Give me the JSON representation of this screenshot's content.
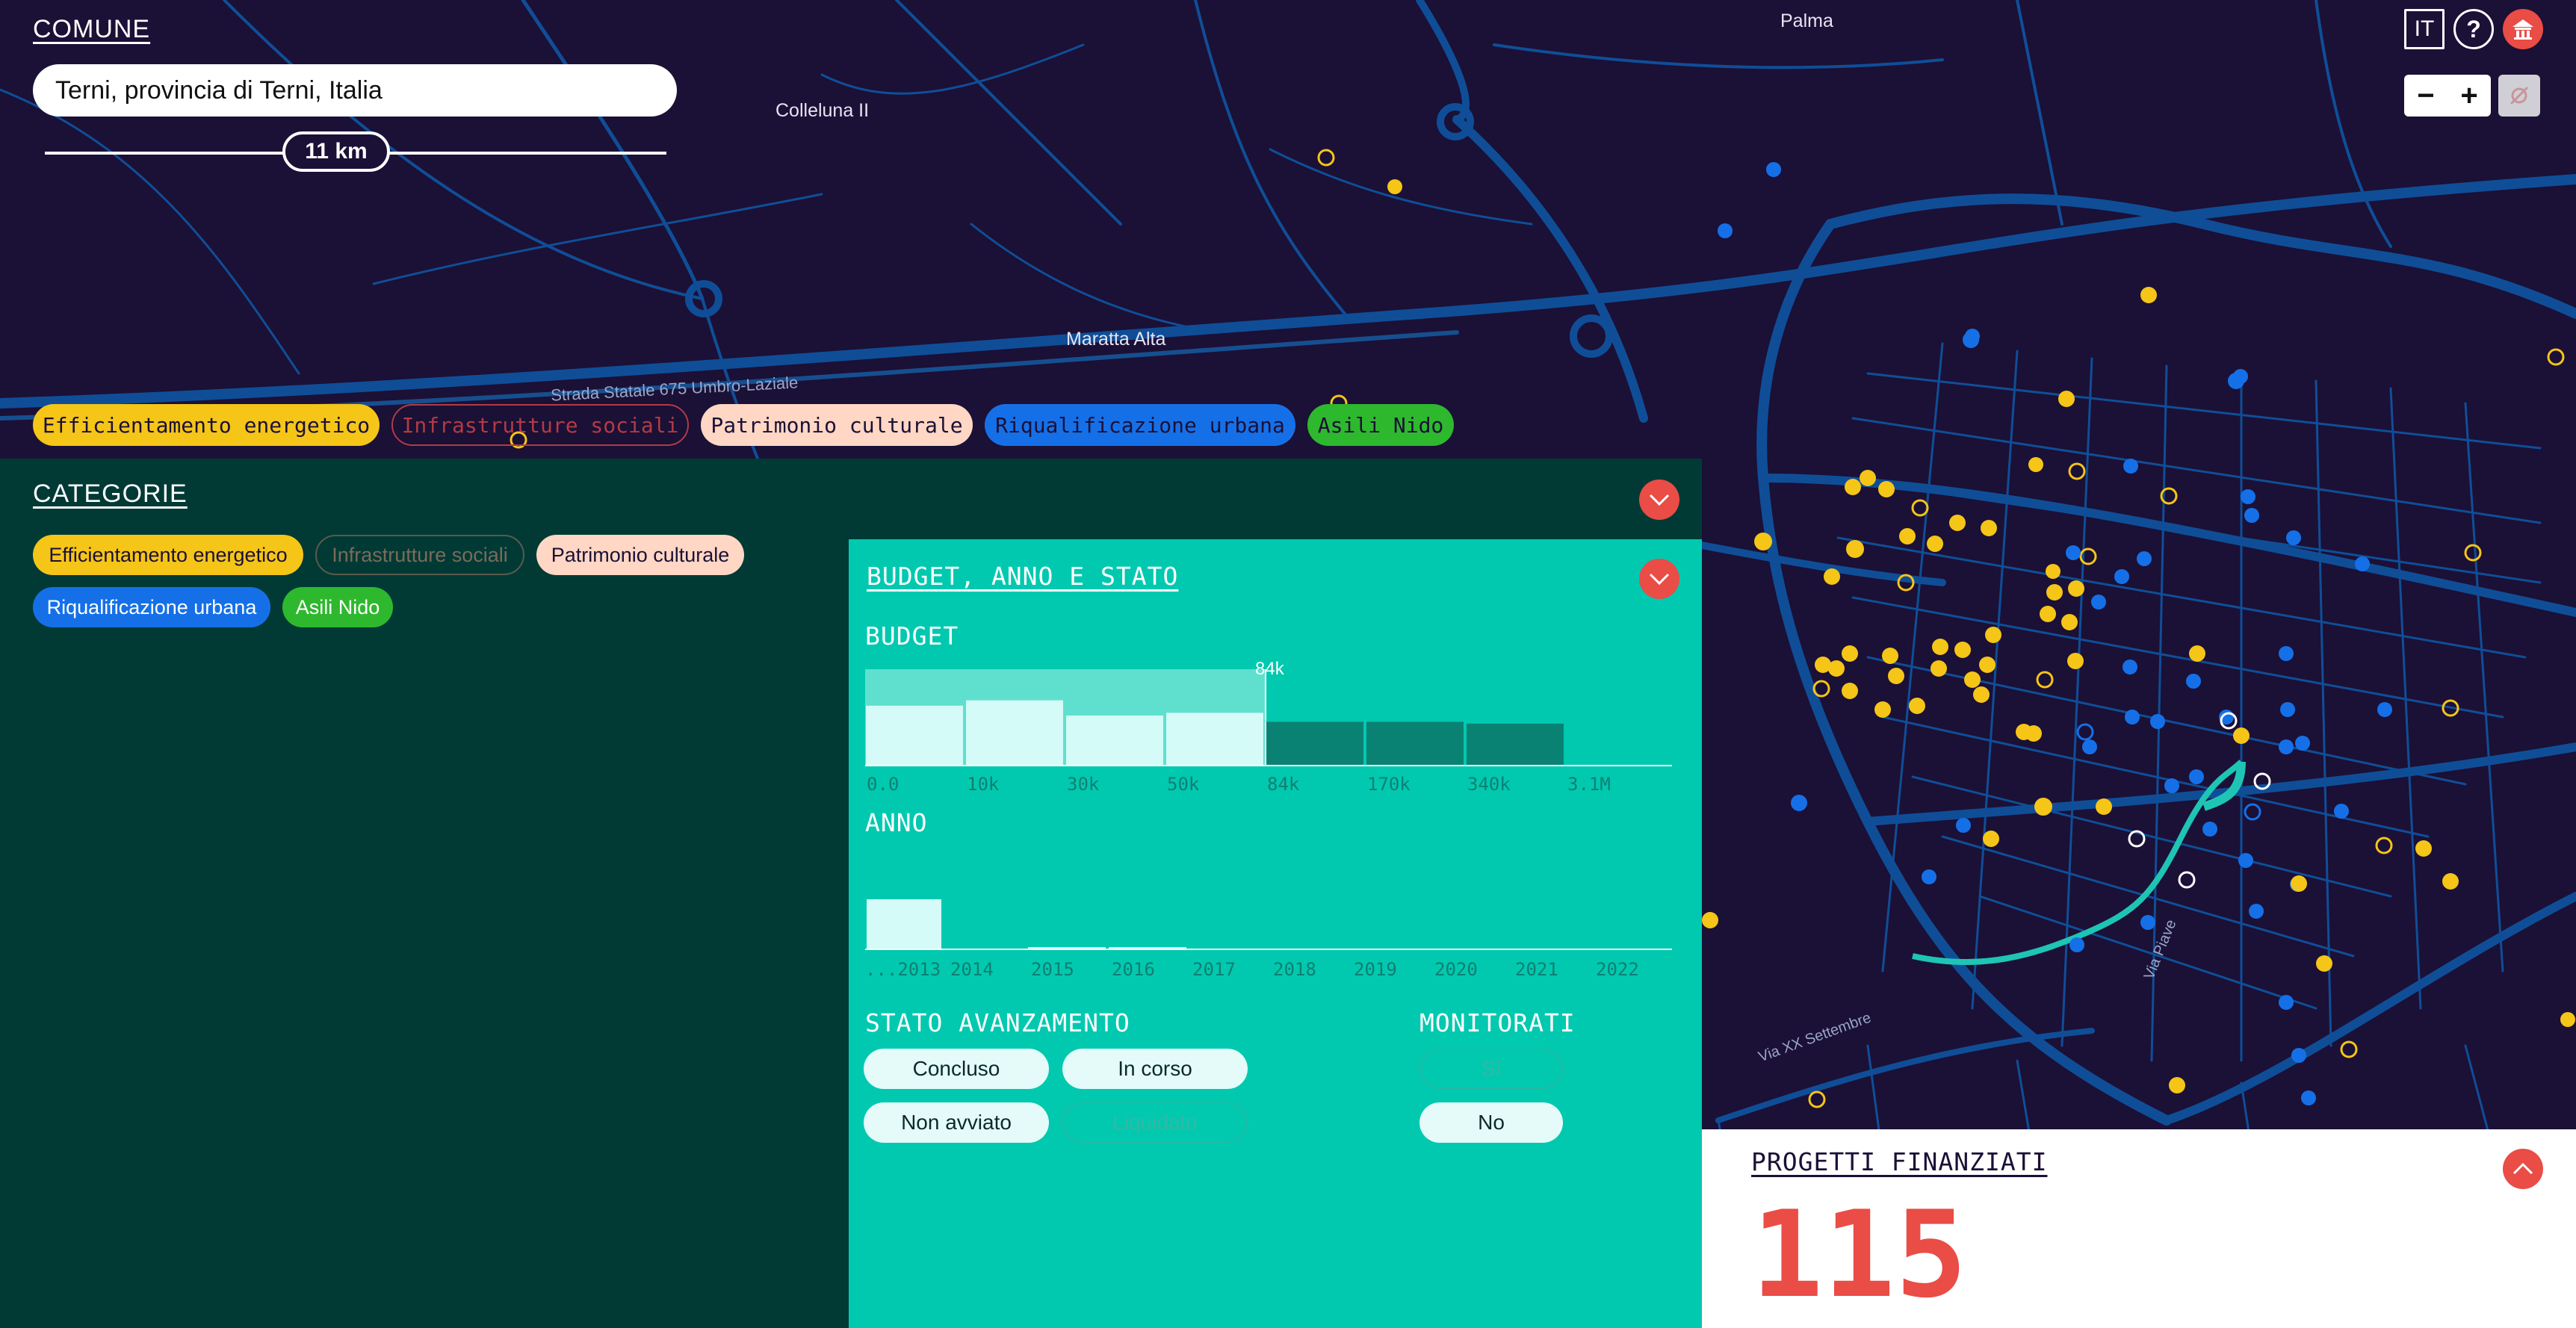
{
  "comune": {
    "title": "COMUNE",
    "value": "Terni, provincia di Terni, Italia",
    "radius_label": "11 km"
  },
  "map": {
    "labels": [
      {
        "id": "palma",
        "text": "Palma"
      },
      {
        "id": "colleluna",
        "text": "Colleluna II"
      },
      {
        "id": "maratta",
        "text": "Maratta Alta"
      },
      {
        "id": "strada",
        "text": "Strada Statale 675 Umbro-Laziale"
      },
      {
        "id": "via-piave",
        "text": "Via Piave"
      },
      {
        "id": "via-xx",
        "text": "Via XX Settembre"
      }
    ],
    "colors": {
      "background": "#1b1036",
      "roads": "#0f4e97",
      "yellow": "#f5c518",
      "blue": "#1570e8"
    }
  },
  "controls": {
    "language": "IT",
    "help": "?",
    "zoom_out": "−",
    "zoom_in": "+"
  },
  "categories": {
    "title": "CATEGORIE",
    "items": [
      {
        "label": "Efficientamento energetico",
        "color": "#f5c518",
        "text_color": "#1b1036",
        "active": true
      },
      {
        "label": "Infrastrutture sociali",
        "color": "#e94c4c",
        "text_color": "#e94c4c",
        "active": false
      },
      {
        "label": "Patrimonio culturale",
        "color": "#ffd7c4",
        "text_color": "#1b1036",
        "active": true
      },
      {
        "label": "Riqualificazione urbana",
        "color": "#1570e8",
        "text_color": "#1b1036",
        "active": true
      },
      {
        "label": "Asili Nido",
        "color": "#2eb82e",
        "text_color": "#1b1036",
        "active": true
      }
    ]
  },
  "budget_panel": {
    "title": "BUDGET, ANNO E STATO",
    "budget_title": "BUDGET",
    "budget_marker": "84k",
    "budget_ticks": [
      "0.0",
      "10k",
      "30k",
      "50k",
      "84k",
      "170k",
      "340k",
      "3.1M"
    ],
    "year_title": "ANNO",
    "year_ticks": [
      "...2013",
      "2014",
      "2015",
      "2016",
      "2017",
      "2018",
      "2019",
      "2020",
      "2021",
      "2022"
    ],
    "status_title": "STATO AVANZAMENTO",
    "status": {
      "concluso": "Concluso",
      "in_corso": "In corso",
      "non_avviato": "Non avviato",
      "liquidato": "Liquidato"
    },
    "monitored_title": "MONITORATI",
    "monitored": {
      "si": "Sì",
      "no": "No"
    }
  },
  "chart_data": [
    {
      "type": "bar",
      "title": "BUDGET",
      "categories": [
        "0.0–10k",
        "10k–30k",
        "30k–50k",
        "50k–84k",
        "84k–170k",
        "170k–340k",
        "340k–3.1M"
      ],
      "values": [
        0.66,
        0.72,
        0.55,
        0.58,
        0.48,
        0.48,
        0.46
      ],
      "selected": [
        true,
        true,
        true,
        true,
        false,
        false,
        false
      ],
      "annotations": [
        "84k"
      ]
    },
    {
      "type": "bar",
      "title": "ANNO",
      "categories": [
        "...2013",
        "2014",
        "2015",
        "2016",
        "2017",
        "2018",
        "2019",
        "2020",
        "2021",
        "2022"
      ],
      "values": [
        1.0,
        0,
        0.03,
        0.03,
        0,
        0,
        0,
        0,
        0,
        0
      ]
    }
  ],
  "progetti": {
    "title": "PROGETTI FINANZIATI",
    "count": "115",
    "color": "#ea4c46"
  }
}
